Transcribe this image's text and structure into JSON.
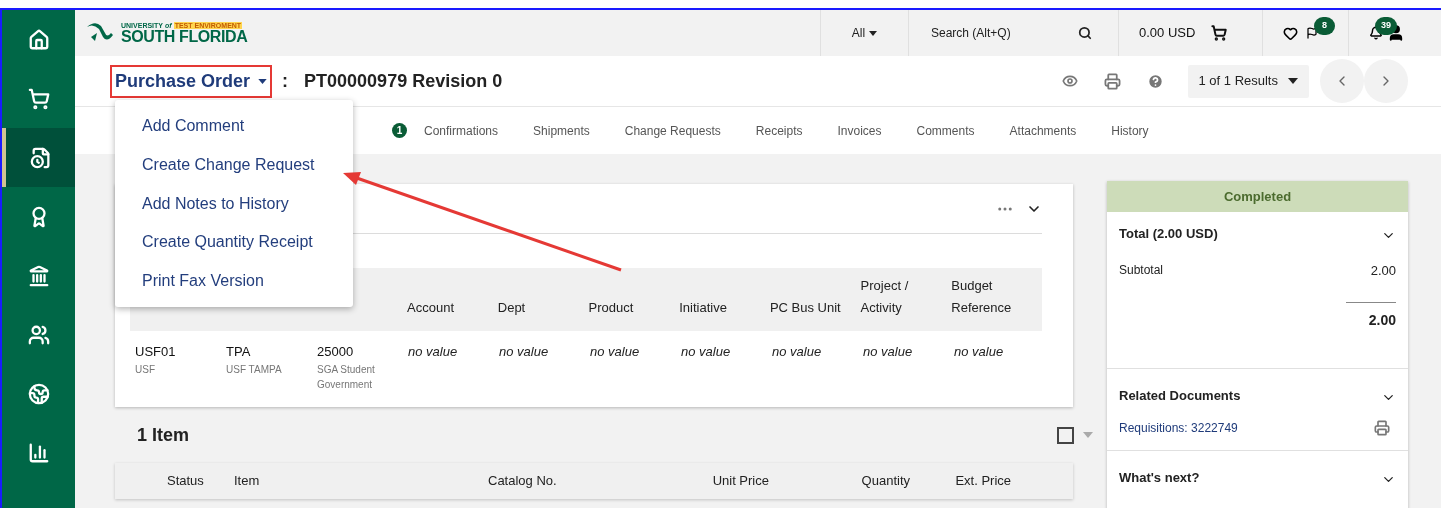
{
  "sidebar": {
    "items": [
      {
        "selected": false
      },
      {
        "selected": false
      },
      {
        "selected": true
      },
      {
        "selected": false
      },
      {
        "selected": false
      },
      {
        "selected": false
      },
      {
        "selected": false
      },
      {
        "selected": false
      }
    ]
  },
  "header": {
    "logo_small": "UNIVERSITY",
    "logo_of": "of",
    "logo_env": "TEST ENVIROMENT",
    "logo_name": "SOUTH FLORIDA",
    "scope": "All",
    "search_placeholder": "Search (Alt+Q)",
    "cart_total": "0.00 USD",
    "flag_count": "8",
    "notification_count": "39"
  },
  "document": {
    "type_menu": "Purchase Order",
    "separator": ":",
    "title": "PT00000979 Revision 0",
    "results": "1 of 1 Results"
  },
  "tab_badge": "1",
  "tabs": [
    {
      "label": "Confirmations",
      "selected": false
    },
    {
      "label": "Shipments",
      "selected": false
    },
    {
      "label": "Change Requests",
      "selected": false
    },
    {
      "label": "Receipts",
      "selected": false
    },
    {
      "label": "Invoices",
      "selected": false
    },
    {
      "label": "Comments",
      "selected": false
    },
    {
      "label": "Attachments",
      "selected": false
    },
    {
      "label": "History",
      "selected": false
    }
  ],
  "menu": {
    "expanded": true,
    "items": [
      {
        "label": "Add Comment"
      },
      {
        "label": "Create Change Request"
      },
      {
        "label": "Add Notes to History"
      },
      {
        "label": "Create Quantity Receipt"
      },
      {
        "label": "Print Fax Version"
      }
    ]
  },
  "accounting": {
    "columns": [
      "",
      "",
      "",
      "Account",
      "Dept",
      "Product",
      "Initiative",
      "PC Bus Unit",
      "Project / Activity",
      "Budget Reference"
    ],
    "rows": [
      {
        "cells": [
          {
            "value": "USF01",
            "sub": "USF",
            "empty": false
          },
          {
            "value": "TPA",
            "sub": "USF TAMPA",
            "empty": false
          },
          {
            "value": "25000",
            "sub": "SGA Student Government",
            "empty": false
          },
          {
            "value": "no value",
            "empty": true
          },
          {
            "value": "no value",
            "empty": true
          },
          {
            "value": "no value",
            "empty": true
          },
          {
            "value": "no value",
            "empty": true
          },
          {
            "value": "no value",
            "empty": true
          },
          {
            "value": "no value",
            "empty": true
          },
          {
            "value": "no value",
            "empty": true
          }
        ]
      }
    ]
  },
  "items_section": {
    "title": "1 Item",
    "select_all_checked": false,
    "columns": [
      "Status",
      "Item",
      "Catalog No.",
      "Unit Price",
      "Quantity",
      "Ext. Price"
    ]
  },
  "summary": {
    "status": "Completed",
    "total_title": "Total (2.00 USD)",
    "subtotal_label": "Subtotal",
    "subtotal": "2.00",
    "total": "2.00",
    "related_title": "Related Documents",
    "requisition_link": "Requisitions: 3222749",
    "next_title": "What's next?"
  }
}
